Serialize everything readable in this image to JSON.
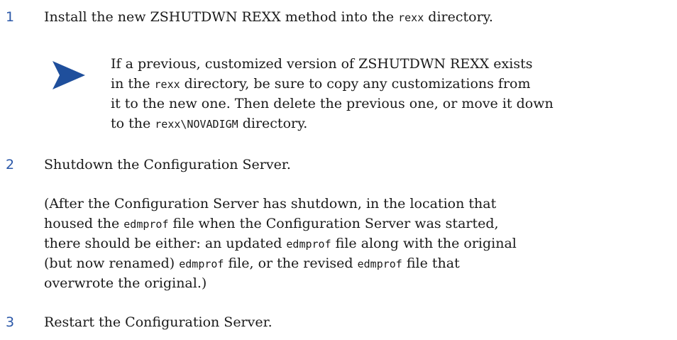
{
  "steps": [
    {
      "number": "1",
      "line": {
        "a": "Install the new ZSHUTDWN REXX method into the ",
        "code": "rexx",
        "b": " directory."
      }
    },
    {
      "number": "2",
      "line": "Shutdown the Configuration Server."
    },
    {
      "number": "3",
      "line": "Restart the Configuration Server."
    }
  ],
  "note": {
    "icon": "note-arrow-icon",
    "color": "#1f4f9c",
    "l1": "If a previous, customized version of ZSHUTDWN REXX exists",
    "l2": {
      "a": "in the ",
      "code": "rexx",
      "b": " directory, be sure to copy any customizations from"
    },
    "l3": "it to the new one. Then delete the previous one, or move it down",
    "l4": {
      "a": "to the ",
      "code": "rexx\\NOVADIGM",
      "b": " directory."
    }
  },
  "para": {
    "l1": "(After the Configuration Server has shutdown, in the location that",
    "l2": {
      "a": "housed the ",
      "code": "edmprof",
      "b": " file when the Configuration Server was started,"
    },
    "l3": {
      "a": "there should be either: an updated ",
      "code": "edmprof",
      "b": " file along with the original"
    },
    "l4": {
      "a": "(but now renamed) ",
      "code": "edmprof",
      "b": " file, or the revised ",
      "code2": "edmprof",
      "c": " file that"
    },
    "l5": "overwrote the original.)"
  },
  "colors": {
    "step_number": "#2a57a8",
    "text": "#1a1a1a"
  }
}
